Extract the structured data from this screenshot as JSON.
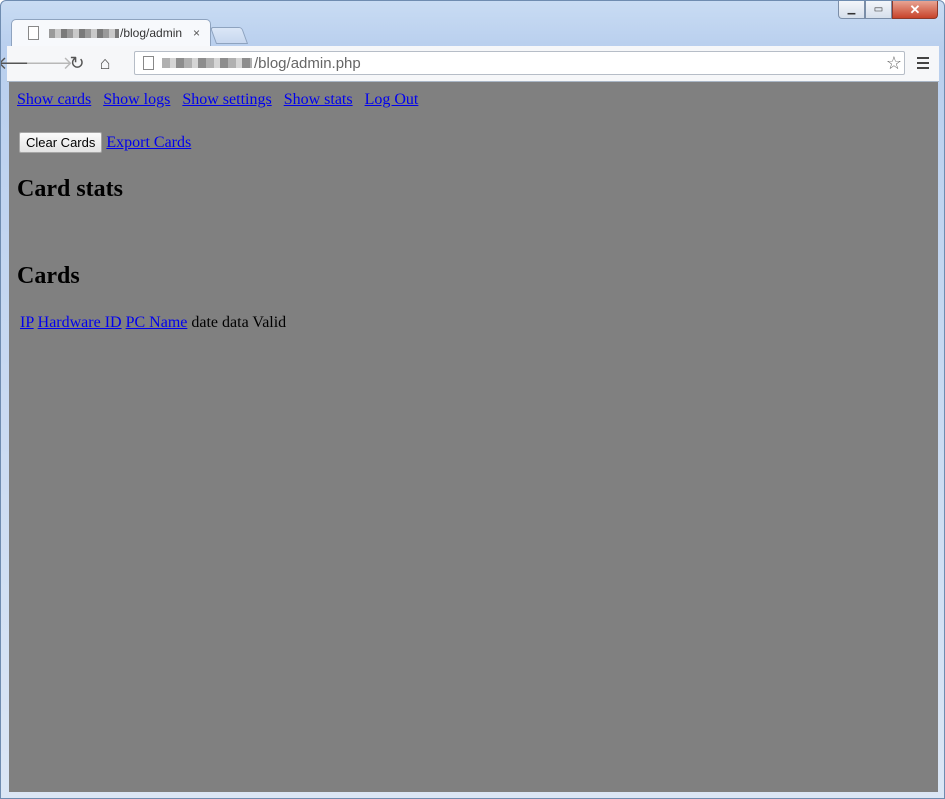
{
  "browser": {
    "tab_title": "/blog/admin",
    "tab_close": "×",
    "url": "/blog/admin.php",
    "back_glyph": "🡐",
    "forward_glyph": "🡒",
    "reload_glyph": "↻",
    "home_glyph": "⌂",
    "star_glyph": "☆",
    "window_buttons": {
      "minimize": "▁",
      "maximize": "▭",
      "close": "✕"
    }
  },
  "nav": {
    "links": [
      "Show cards",
      "Show logs",
      "Show settings",
      "Show stats",
      "Log Out"
    ]
  },
  "actions": {
    "clear_label": "Clear Cards",
    "export_label": "Export Cards"
  },
  "headings": {
    "card_stats": "Card stats",
    "cards": "Cards"
  },
  "cards_table": {
    "link_columns": [
      "IP",
      "Hardware ID",
      "PC Name"
    ],
    "plain_columns": [
      "date",
      "data",
      "Valid"
    ]
  },
  "colors": {
    "page_background": "#808080",
    "link": "#0000ee"
  }
}
